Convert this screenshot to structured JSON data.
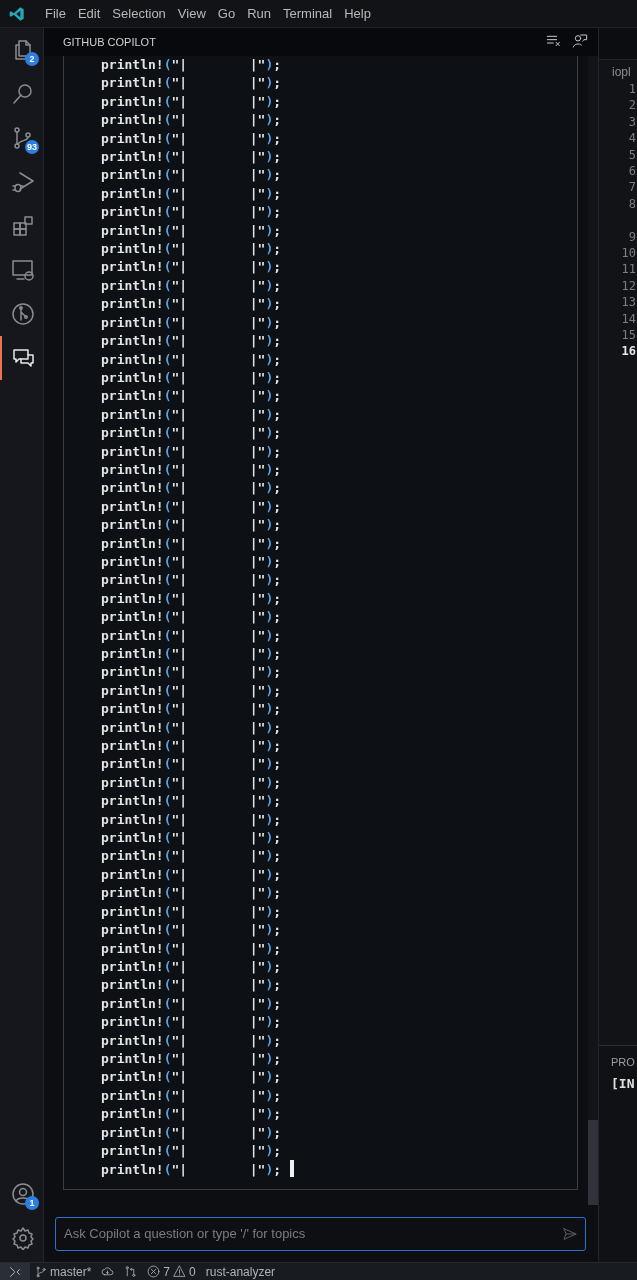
{
  "menu_bar": {
    "items": [
      "File",
      "Edit",
      "Selection",
      "View",
      "Go",
      "Run",
      "Terminal",
      "Help"
    ]
  },
  "activity_bar": {
    "items": [
      {
        "kind": "files",
        "badge": "2",
        "selected": false
      },
      {
        "kind": "search",
        "selected": false
      },
      {
        "kind": "source-control",
        "badge": "93",
        "selected": false
      },
      {
        "kind": "run-debug",
        "selected": false
      },
      {
        "kind": "extensions",
        "selected": false
      },
      {
        "kind": "remote",
        "selected": false
      },
      {
        "kind": "git-graph",
        "selected": false
      },
      {
        "kind": "chat",
        "selected": true
      }
    ],
    "bottom": [
      {
        "kind": "account",
        "badge": "1"
      },
      {
        "kind": "settings"
      }
    ]
  },
  "chat_panel": {
    "title": "GITHUB COPILOT",
    "cursor": true,
    "code_lines": [
      "println!(\"|        |\");",
      "println!(\"|        |\");",
      "println!(\"|        |\");",
      "println!(\"|        |\");",
      "println!(\"|        |\");",
      "println!(\"|        |\");",
      "println!(\"|        |\");",
      "println!(\"|        |\");",
      "println!(\"|        |\");",
      "println!(\"|        |\");",
      "println!(\"|        |\");",
      "println!(\"|        |\");",
      "println!(\"|        |\");",
      "println!(\"|        |\");",
      "println!(\"|        |\");",
      "println!(\"|        |\");",
      "println!(\"|        |\");",
      "println!(\"|        |\");",
      "println!(\"|        |\");",
      "println!(\"|        |\");",
      "println!(\"|        |\");",
      "println!(\"|        |\");",
      "println!(\"|        |\");",
      "println!(\"|        |\");",
      "println!(\"|        |\");",
      "println!(\"|        |\");",
      "println!(\"|        |\");",
      "println!(\"|        |\");",
      "println!(\"|        |\");",
      "println!(\"|        |\");",
      "println!(\"|        |\");",
      "println!(\"|        |\");",
      "println!(\"|        |\");",
      "println!(\"|        |\");",
      "println!(\"|        |\");",
      "println!(\"|        |\");",
      "println!(\"|        |\");",
      "println!(\"|        |\");",
      "println!(\"|        |\");",
      "println!(\"|        |\");",
      "println!(\"|        |\");",
      "println!(\"|        |\");",
      "println!(\"|        |\");",
      "println!(\"|        |\");",
      "println!(\"|        |\");",
      "println!(\"|        |\");",
      "println!(\"|        |\");",
      "println!(\"|        |\");",
      "println!(\"|        |\");",
      "println!(\"|        |\");",
      "println!(\"|        |\");",
      "println!(\"|        |\");",
      "println!(\"|        |\");",
      "println!(\"|        |\");",
      "println!(\"|        |\");",
      "println!(\"|        |\");",
      "println!(\"|        |\");",
      "println!(\"|        |\");",
      "println!(\"|        |\");",
      "println!(\"|        |\");",
      "println!(\"|        |\");"
    ],
    "input": {
      "placeholder": "Ask Copilot a question or type '/' for topics"
    }
  },
  "editor": {
    "tab_label": "iopl",
    "line_numbers": [
      {
        "text": "1",
        "current": false
      },
      {
        "text": "2",
        "current": false
      },
      {
        "text": "3",
        "current": false
      },
      {
        "text": "4",
        "current": false
      },
      {
        "text": "5",
        "current": false
      },
      {
        "text": "6",
        "current": false
      },
      {
        "text": "7",
        "current": false
      },
      {
        "text": "8",
        "current": false,
        "wraps": true
      },
      {
        "text": "9",
        "current": false
      },
      {
        "text": "10",
        "current": false
      },
      {
        "text": "11",
        "current": false
      },
      {
        "text": "12",
        "current": false
      },
      {
        "text": "13",
        "current": false
      },
      {
        "text": "14",
        "current": false
      },
      {
        "text": "15",
        "current": false
      },
      {
        "text": "16",
        "current": true
      }
    ]
  },
  "panel": {
    "tab_label": "PRO",
    "output_line": "[IN"
  },
  "status_bar": {
    "branch": "master*",
    "errors": "7",
    "warnings": "0",
    "language_server": "rust-analyzer"
  }
}
